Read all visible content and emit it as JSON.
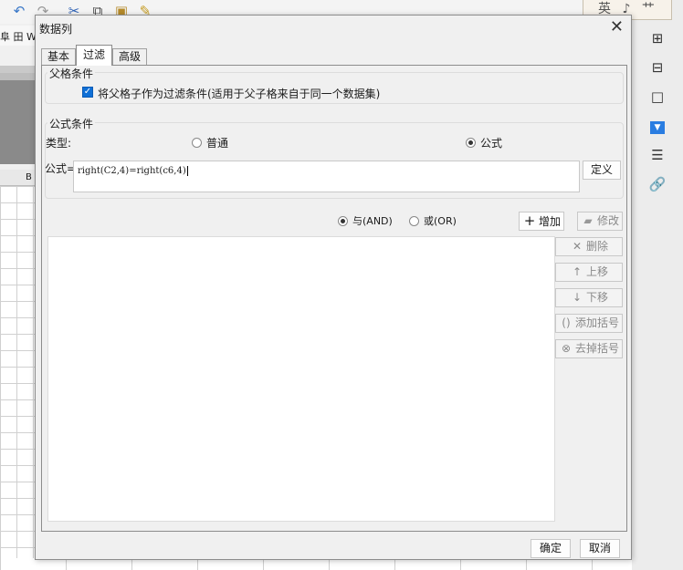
{
  "background_app": {
    "toolbar_icons": [
      "undo-icon",
      "redo-icon",
      "cut-icon",
      "copy-icon",
      "paste-icon",
      "format-painter-icon"
    ],
    "row2_label": "阜 田 W",
    "column_header": "B",
    "ime_indicator": "英 ♪ ⺾"
  },
  "dialog": {
    "title": "数据列",
    "close_glyph": "✕",
    "tabs": [
      {
        "label": "基本",
        "active": false
      },
      {
        "label": "过滤",
        "active": true
      },
      {
        "label": "高级",
        "active": false
      }
    ],
    "parent_condition": {
      "title": "父格条件",
      "checkbox_checked": true,
      "checkbox_label": "将父格子作为过滤条件(适用于父子格来自于同一个数据集)"
    },
    "formula_condition": {
      "title": "公式条件",
      "type_label": "类型:",
      "type_options": [
        {
          "label": "普通",
          "selected": false
        },
        {
          "label": "公式",
          "selected": true
        }
      ],
      "formula_label": "公式=",
      "formula_value": "right(C2,4)=right(c6,4)",
      "define_button": "定义"
    },
    "logic": {
      "options": [
        {
          "label": "与(AND)",
          "selected": true
        },
        {
          "label": "或(OR)",
          "selected": false
        }
      ]
    },
    "actions": {
      "add": "增加",
      "modify": "修改",
      "delete": "删除",
      "move_up": "上移",
      "move_down": "下移",
      "add_bracket": "添加括号",
      "remove_bracket": "去掉括号"
    },
    "footer": {
      "ok": "确定",
      "cancel": "取消"
    }
  },
  "colors": {
    "accent": "#0f6fd6",
    "selected_tool": "#2a7de1"
  }
}
